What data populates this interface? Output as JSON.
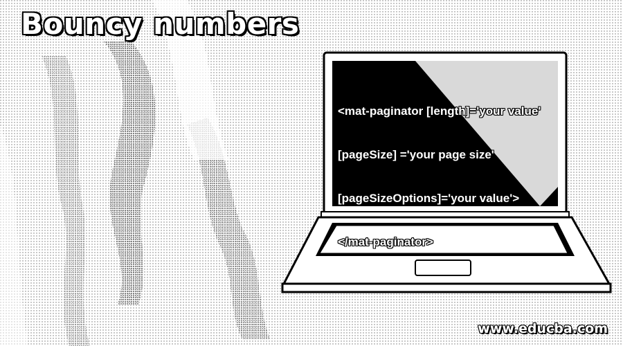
{
  "title": "Bouncy numbers",
  "code_lines": [
    "<mat-paginator [length]='your value'",
    "[pageSize] ='your page size'",
    "[pageSizeOptions]='your value'>",
    "</mat-paginator>"
  ],
  "website": "www.educba.com",
  "icons": {
    "laptop": "laptop-icon"
  },
  "colors": {
    "text_fill": "#ffffff",
    "outline": "#000000",
    "background": "#ffffff"
  }
}
